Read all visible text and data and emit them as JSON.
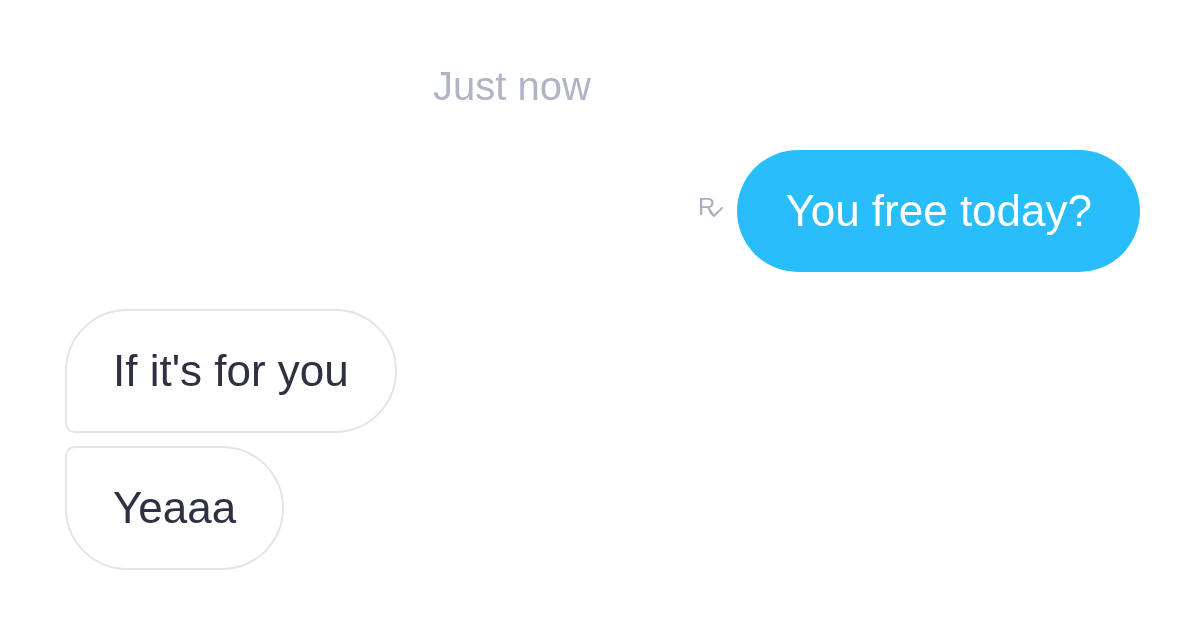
{
  "timestamp": "Just now",
  "messages": [
    {
      "kind": "outgoing",
      "text": "You free today?",
      "receipt": "R"
    },
    {
      "kind": "incoming",
      "text": "If it's for you",
      "joined_above": false,
      "joined_below": true
    },
    {
      "kind": "incoming",
      "text": "Yeaaa",
      "joined_above": true,
      "joined_below": false
    }
  ]
}
